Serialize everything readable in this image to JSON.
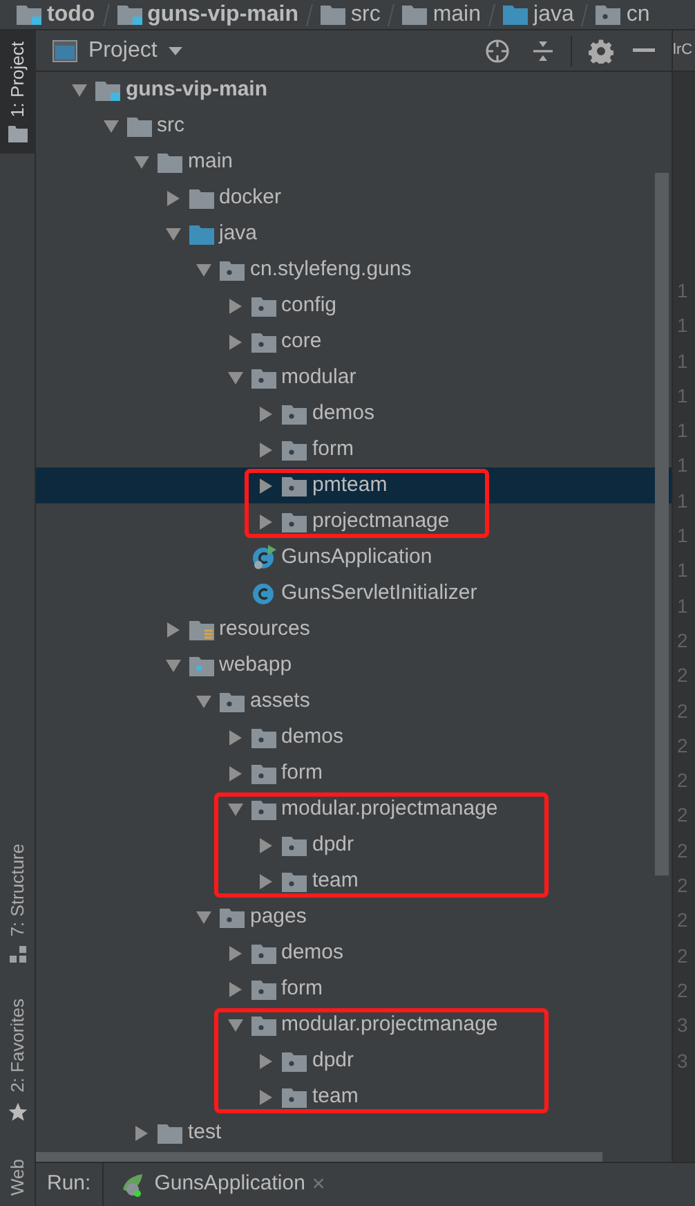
{
  "breadcrumb": [
    {
      "label": "todo",
      "kind": "module"
    },
    {
      "label": "guns-vip-main",
      "kind": "module"
    },
    {
      "label": "src",
      "kind": "folder"
    },
    {
      "label": "main",
      "kind": "folder"
    },
    {
      "label": "java",
      "kind": "source"
    },
    {
      "label": "cn",
      "kind": "package"
    }
  ],
  "tool_strip_top": [
    {
      "label": "1: Project",
      "kind": "project",
      "selected": true
    }
  ],
  "tool_strip_bottom": [
    {
      "label": "7: Structure",
      "kind": "structure",
      "selected": false
    },
    {
      "label": "2: Favorites",
      "kind": "favorites",
      "selected": false
    },
    {
      "label": "Web",
      "kind": "web",
      "selected": false
    }
  ],
  "panel": {
    "title": "Project"
  },
  "tree": [
    {
      "label": "guns-vip-main",
      "kind": "module",
      "expanded": true,
      "selected": false,
      "outlined": false,
      "children": [
        {
          "label": "src",
          "kind": "folder",
          "expanded": true,
          "selected": false,
          "outlined": false,
          "children": [
            {
              "label": "main",
              "kind": "folder",
              "expanded": true,
              "selected": false,
              "outlined": false,
              "children": [
                {
                  "label": "docker",
                  "kind": "folder",
                  "expanded": false,
                  "selected": false,
                  "outlined": false
                },
                {
                  "label": "java",
                  "kind": "source",
                  "expanded": true,
                  "selected": false,
                  "outlined": false,
                  "children": [
                    {
                      "label": "cn.stylefeng.guns",
                      "kind": "package",
                      "expanded": true,
                      "selected": false,
                      "outlined": false,
                      "children": [
                        {
                          "label": "config",
                          "kind": "package",
                          "expanded": false,
                          "selected": false,
                          "outlined": false
                        },
                        {
                          "label": "core",
                          "kind": "package",
                          "expanded": false,
                          "selected": false,
                          "outlined": false
                        },
                        {
                          "label": "modular",
                          "kind": "package",
                          "expanded": true,
                          "selected": false,
                          "outlined": false,
                          "children": [
                            {
                              "label": "demos",
                              "kind": "package",
                              "expanded": false,
                              "selected": false,
                              "outlined": false
                            },
                            {
                              "label": "form",
                              "kind": "package",
                              "expanded": false,
                              "selected": false,
                              "outlined": false
                            },
                            {
                              "label": "pmteam",
                              "kind": "package",
                              "expanded": false,
                              "selected": true,
                              "outlined": true
                            },
                            {
                              "label": "projectmanage",
                              "kind": "package",
                              "expanded": false,
                              "selected": false,
                              "outlined": true
                            }
                          ]
                        },
                        {
                          "label": "GunsApplication",
                          "kind": "app_class",
                          "expanded": false,
                          "selected": false,
                          "outlined": false
                        },
                        {
                          "label": "GunsServletInitializer",
                          "kind": "class",
                          "expanded": false,
                          "selected": false,
                          "outlined": false
                        }
                      ]
                    }
                  ]
                },
                {
                  "label": "resources",
                  "kind": "resources",
                  "expanded": false,
                  "selected": false,
                  "outlined": false
                },
                {
                  "label": "webapp",
                  "kind": "web",
                  "expanded": true,
                  "selected": false,
                  "outlined": false,
                  "children": [
                    {
                      "label": "assets",
                      "kind": "package",
                      "expanded": true,
                      "selected": false,
                      "outlined": false,
                      "children": [
                        {
                          "label": "demos",
                          "kind": "package",
                          "expanded": false,
                          "selected": false,
                          "outlined": false
                        },
                        {
                          "label": "form",
                          "kind": "package",
                          "expanded": false,
                          "selected": false,
                          "outlined": false
                        },
                        {
                          "label": "modular.projectmanage",
                          "kind": "package",
                          "expanded": true,
                          "selected": false,
                          "outlined": true,
                          "children": [
                            {
                              "label": "dpdr",
                              "kind": "package",
                              "expanded": false,
                              "selected": false,
                              "outlined": false
                            },
                            {
                              "label": "team",
                              "kind": "package",
                              "expanded": false,
                              "selected": false,
                              "outlined": false
                            }
                          ]
                        }
                      ]
                    },
                    {
                      "label": "pages",
                      "kind": "package",
                      "expanded": true,
                      "selected": false,
                      "outlined": false,
                      "children": [
                        {
                          "label": "demos",
                          "kind": "package",
                          "expanded": false,
                          "selected": false,
                          "outlined": false
                        },
                        {
                          "label": "form",
                          "kind": "package",
                          "expanded": false,
                          "selected": false,
                          "outlined": false
                        },
                        {
                          "label": "modular.projectmanage",
                          "kind": "package",
                          "expanded": true,
                          "selected": false,
                          "outlined": true,
                          "children": [
                            {
                              "label": "dpdr",
                              "kind": "package",
                              "expanded": false,
                              "selected": false,
                              "outlined": false
                            },
                            {
                              "label": "team",
                              "kind": "package",
                              "expanded": false,
                              "selected": false,
                              "outlined": false
                            }
                          ]
                        }
                      ]
                    }
                  ]
                }
              ]
            },
            {
              "label": "test",
              "kind": "folder",
              "expanded": false,
              "selected": false,
              "outlined": false
            }
          ]
        }
      ]
    }
  ],
  "run_bar": {
    "label": "Run:",
    "tab": "GunsApplication",
    "close": "×"
  },
  "editor": {
    "tab_fragment": "lrC",
    "line_numbers": [
      "1",
      "1",
      "1",
      "1",
      "1",
      "1",
      "1",
      "1",
      "1",
      "1",
      "2",
      "2",
      "2",
      "2",
      "2",
      "2",
      "2",
      "2",
      "2",
      "2",
      "2",
      "3",
      "3"
    ]
  }
}
